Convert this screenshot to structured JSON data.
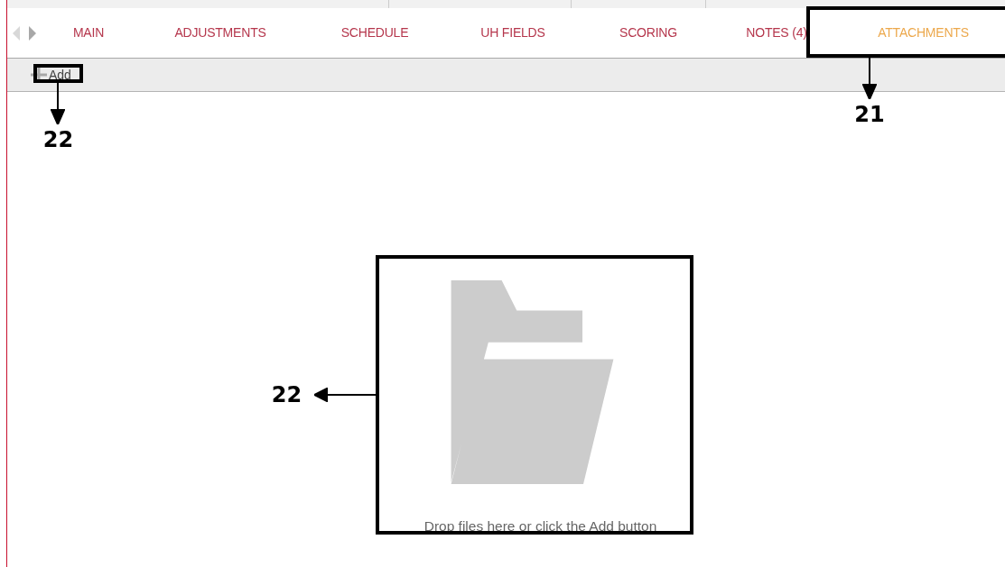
{
  "tabs": [
    {
      "label": "MAIN",
      "selected": false
    },
    {
      "label": "ADJUSTMENTS",
      "selected": false
    },
    {
      "label": "SCHEDULE",
      "selected": false
    },
    {
      "label": "UH FIELDS",
      "selected": false
    },
    {
      "label": "SCORING",
      "selected": false
    },
    {
      "label": "NOTES (4)",
      "selected": false
    },
    {
      "label": "ATTACHMENTS",
      "selected": true
    }
  ],
  "toolbar": {
    "add_button": {
      "label": "Add"
    }
  },
  "drop_zone": {
    "message": "Drop files here or click the Add button"
  },
  "callouts": [
    {
      "kind": "add-button",
      "label": "22"
    },
    {
      "kind": "active-tab",
      "label": "21"
    },
    {
      "kind": "drop-zone",
      "label": "22"
    }
  ]
}
